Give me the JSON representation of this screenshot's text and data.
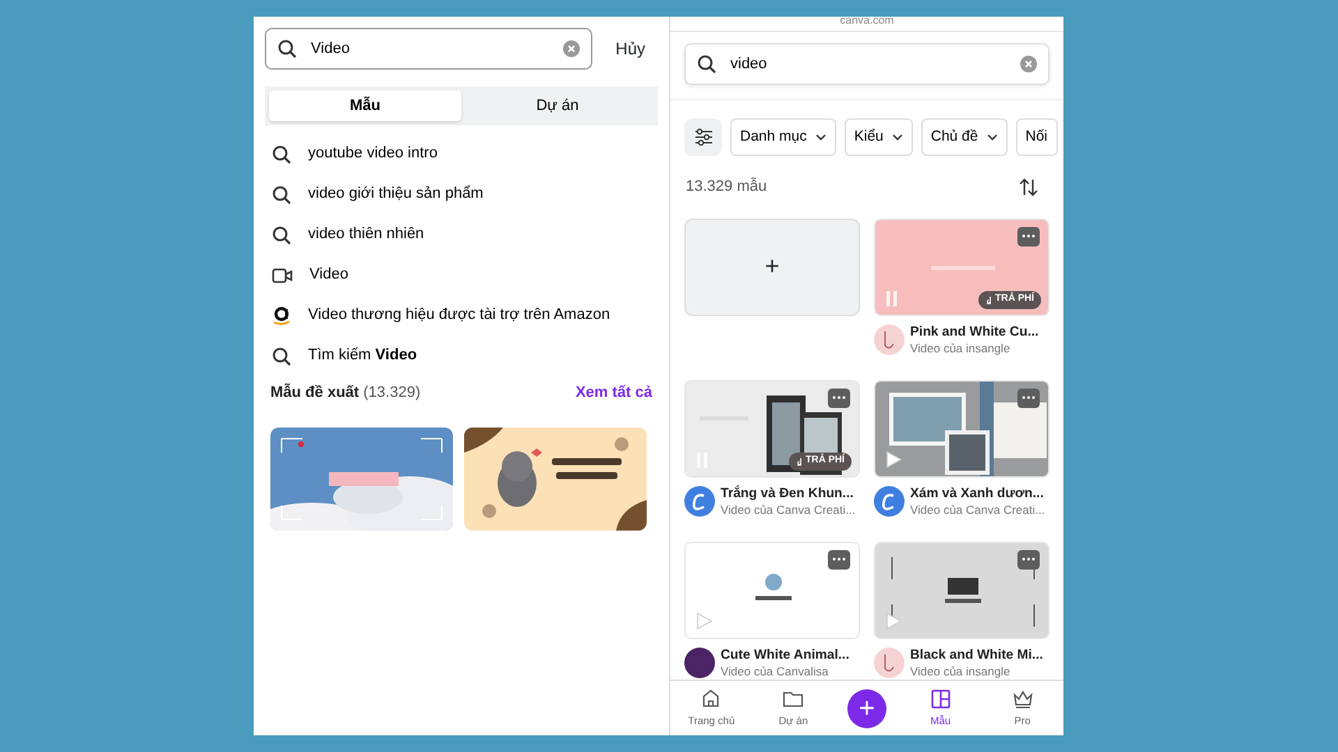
{
  "left_panel": {
    "search": {
      "value": "Video"
    },
    "cancel": "Hủy",
    "tabs": [
      {
        "label": "Mẫu",
        "selected": true
      },
      {
        "label": "Dự án",
        "selected": false
      }
    ],
    "suggestions": [
      {
        "kind": "search",
        "text": "youtube video intro"
      },
      {
        "kind": "search",
        "text": "video giới thiệu sản phẩm"
      },
      {
        "kind": "search",
        "text": "video thiên nhiên"
      },
      {
        "kind": "video",
        "text": "Video"
      },
      {
        "kind": "amazon",
        "text": "Video thương hiệu được tài trợ trên Amazon"
      },
      {
        "kind": "search",
        "text": "Tìm kiếm **Video**"
      }
    ],
    "section": {
      "title": "Mẫu đề xuất",
      "count": "(13.329)",
      "link": "Xem tất cả"
    }
  },
  "right_panel": {
    "address": "canva.com",
    "search": {
      "value": "video"
    },
    "filters": [
      "Danh mục",
      "Kiểu",
      "Chủ đề",
      "Nối"
    ],
    "result_count": "13.329 mẫu",
    "templates": [
      {
        "kind": "create",
        "label": "+"
      },
      {
        "kind": "template",
        "title": "Pink and White Cu...",
        "author": "Video của insangle",
        "paid": true,
        "badge": "TRẢ PHÍ"
      },
      {
        "kind": "template",
        "title": "Trắng và Đen Khun...",
        "author": "Video của Canva Creati...",
        "paid": true,
        "badge": "TRẢ PHÍ"
      },
      {
        "kind": "template",
        "title": "Xám và Xanh dươn...",
        "author": "Video của Canva Creati...",
        "paid": false
      },
      {
        "kind": "template",
        "title": "Cute White Animal...",
        "author": "Video của Canvalisa",
        "paid": false
      },
      {
        "kind": "template",
        "title": "Black and White Mi...",
        "author": "Video của insangle",
        "paid": false
      }
    ],
    "nav": [
      {
        "label": "Trang chủ",
        "selected": false
      },
      {
        "label": "Dự án",
        "selected": false
      },
      {
        "kind": "create",
        "label": "+",
        "selected": false
      },
      {
        "label": "Mẫu",
        "selected": true
      },
      {
        "label": "Pro",
        "selected": false
      }
    ]
  }
}
